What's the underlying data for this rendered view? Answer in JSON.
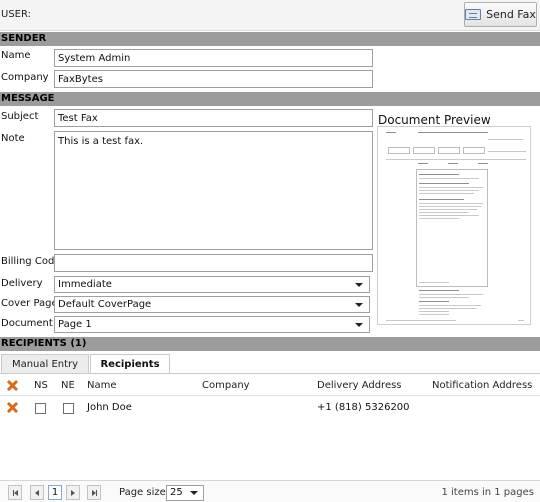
{
  "header": {
    "user_label": "USER:",
    "send_fax_label": "Send Fax"
  },
  "sender": {
    "section_title": "SENDER",
    "name_label": "Name",
    "name_value": "System Admin",
    "company_label": "Company",
    "company_value": "FaxBytes"
  },
  "message": {
    "section_title": "MESSAGE",
    "subject_label": "Subject",
    "subject_value": "Test Fax",
    "note_label": "Note",
    "note_value": "This is a test fax.",
    "billing_label": "Billing Code",
    "billing_value": "",
    "delivery_label": "Delivery",
    "delivery_value": "Immediate",
    "cover_label": "Cover Page",
    "cover_value": "Default CoverPage",
    "document_label": "Document",
    "document_value": "Page 1",
    "preview_title": "Document Preview"
  },
  "recipients": {
    "section_title": "RECIPIENTS (1)",
    "tabs": [
      {
        "label": "Manual Entry"
      },
      {
        "label": "Recipients"
      }
    ],
    "columns": {
      "ns": "NS",
      "ne": "NE",
      "name": "Name",
      "company": "Company",
      "delivery": "Delivery Address",
      "notification": "Notification Address"
    },
    "rows": [
      {
        "name": "John Doe",
        "company": "",
        "delivery": "+1 (818) 5326200",
        "notification": ""
      }
    ]
  },
  "pager": {
    "current_page": "1",
    "page_size_label": "Page size:",
    "page_size_value": "25",
    "info": "1 items in 1 pages"
  },
  "colors": {
    "section_bar": "#9c9c9c",
    "remove_icon": "#d76b1e"
  }
}
